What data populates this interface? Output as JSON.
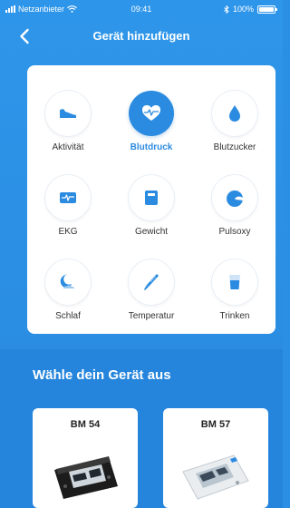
{
  "status_bar": {
    "carrier": "Netzanbieter",
    "time": "09:41",
    "battery": "100%"
  },
  "nav": {
    "title": "Gerät hinzufügen"
  },
  "categories": [
    {
      "label": "Aktivität",
      "icon": "sneaker-icon",
      "selected": false
    },
    {
      "label": "Blutdruck",
      "icon": "heart-pulse-icon",
      "selected": true
    },
    {
      "label": "Blutzucker",
      "icon": "drop-icon",
      "selected": false
    },
    {
      "label": "EKG",
      "icon": "ecg-monitor-icon",
      "selected": false
    },
    {
      "label": "Gewicht",
      "icon": "scale-icon",
      "selected": false
    },
    {
      "label": "Pulsoxy",
      "icon": "pulse-oximeter-icon",
      "selected": false
    },
    {
      "label": "Schlaf",
      "icon": "moon-cloud-icon",
      "selected": false
    },
    {
      "label": "Temperatur",
      "icon": "thermometer-icon",
      "selected": false
    },
    {
      "label": "Trinken",
      "icon": "glass-icon",
      "selected": false
    }
  ],
  "device_section": {
    "heading": "Wähle dein Gerät aus",
    "devices": [
      {
        "name": "BM 54"
      },
      {
        "name": "BM 57"
      }
    ]
  },
  "colors": {
    "accent": "#2b8be0",
    "background": "#2b8fe3",
    "card": "#ffffff"
  }
}
